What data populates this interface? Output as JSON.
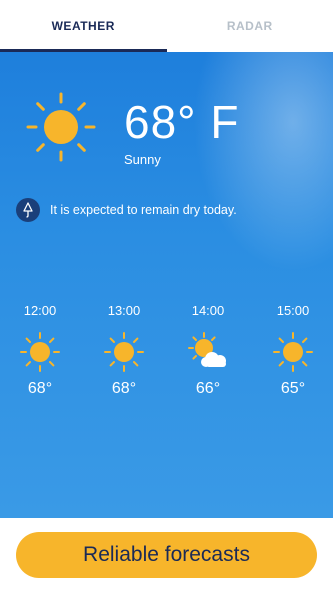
{
  "tabs": [
    {
      "label": "WEATHER",
      "active": true
    },
    {
      "label": "RADAR",
      "active": false
    }
  ],
  "current": {
    "temperature": "68° F",
    "condition": "Sunny",
    "icon": "sun-icon"
  },
  "note": {
    "icon": "umbrella-icon",
    "text": "It is expected to remain dry today."
  },
  "hourly": [
    {
      "time": "12:00",
      "temp": "68°",
      "icon": "sun-icon"
    },
    {
      "time": "13:00",
      "temp": "68°",
      "icon": "sun-icon"
    },
    {
      "time": "14:00",
      "temp": "66°",
      "icon": "partly-cloudy-icon"
    },
    {
      "time": "15:00",
      "temp": "65°",
      "icon": "sun-icon"
    }
  ],
  "cta": {
    "label": "Reliable forecasts"
  },
  "colors": {
    "accent": "#f7b52b",
    "navy": "#1a2a57",
    "sky": "#2b8ee2"
  }
}
